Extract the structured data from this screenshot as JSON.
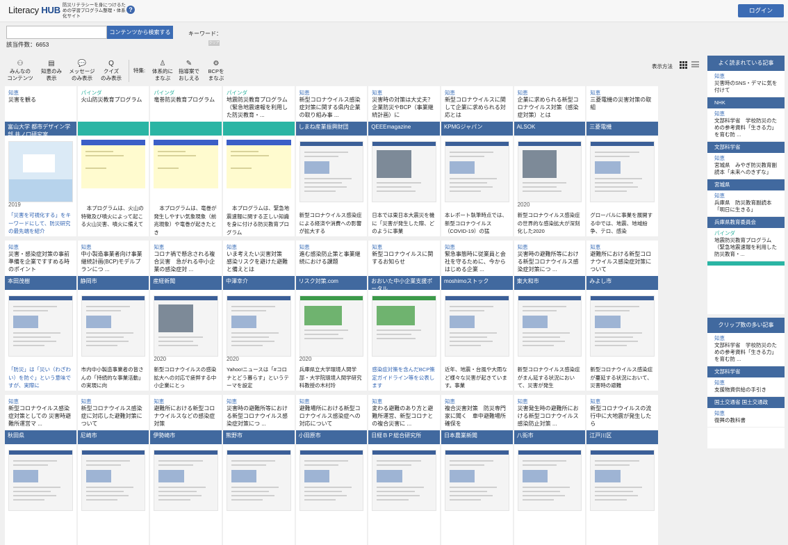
{
  "header": {
    "logo_prefix": "Literacy ",
    "logo_bold": "HUB",
    "tagline": "防災リテラシーを身につけるための学習プログラム整理・体系化サイト",
    "help_icon": "?",
    "login_label": "ログイン"
  },
  "search": {
    "input_value": "",
    "button_label": "コンテンツから検索する",
    "keyword_label": "キーワード：",
    "keyword_chip": "クリア",
    "count_label": "該当件数：6653"
  },
  "filters": [
    {
      "icon": "people-icon",
      "glyph": "⚇",
      "label1": "みんなの",
      "label2": "コンテンツ"
    },
    {
      "icon": "doc-icon",
      "glyph": "▤",
      "label1": "知恵のみ",
      "label2": "表示"
    },
    {
      "icon": "message-icon",
      "glyph": "💬",
      "label1": "メッセージ",
      "label2": "のみ表示"
    },
    {
      "icon": "quiz-icon",
      "glyph": "Q",
      "label1": "クイズ",
      "label2": "のみ表示"
    }
  ],
  "features_label": "特集:",
  "features": [
    {
      "icon": "person-icon",
      "glyph": "♙",
      "label1": "体系的に",
      "label2": "まなぶ"
    },
    {
      "icon": "book-icon",
      "glyph": "✎",
      "label1": "指導案で",
      "label2": "おしえる"
    },
    {
      "icon": "gear-icon",
      "glyph": "⚙",
      "label1": "BCPを",
      "label2": "まなぶ"
    }
  ],
  "view": {
    "label": "表示方法"
  },
  "cards": [
    {
      "cat": "知恵",
      "title": "災害を観る",
      "source": "富山大学 都市デザイン学部 井ノ口研究室",
      "teal": false,
      "thumb": "blue",
      "year": "2019",
      "desc": "「災害を可視化する」をキーワードにして、防災研究の最先端を紹介",
      "desc_blue": true,
      "pg": false
    },
    {
      "cat": "パインダ",
      "title": "火山防災教育プログラム",
      "source": "",
      "teal": true,
      "thumb": "yellow",
      "year": "",
      "desc": "本プログラムは、火山の特徴及び噴火によって起こる火山災害、噴火に備えて",
      "desc_blue": false,
      "pg": true
    },
    {
      "cat": "パインダ",
      "title": "竜巻防災教育プログラム",
      "source": "",
      "teal": true,
      "thumb": "yellow",
      "year": "",
      "desc": "本プログラムは、竜巻が発生しやすい気象現象（前兆現象）や竜巻が起きたとき",
      "desc_blue": false,
      "pg": true
    },
    {
      "cat": "パインダ",
      "title": "地震防災教育プログラム（緊急地震速報を利用した防災教育・...",
      "source": "",
      "teal": true,
      "thumb": "yellow",
      "year": "",
      "desc": "本プログラムは、緊急地震速報に関する正しい知識を身に付ける防災教育プログラム",
      "desc_blue": false,
      "pg": true
    },
    {
      "cat": "知恵",
      "title": "新型コロナウイルス感染症対策に関する県内企業の取り組み事 ...",
      "source": "しまね産業振興財団",
      "teal": false,
      "thumb": "doc",
      "year": "",
      "desc": "新型コロナウイルス感染症による経済や消費への影響が拡大する",
      "desc_blue": false,
      "pg": false
    },
    {
      "cat": "知恵",
      "title": "災害時の対策は大丈夫？企業防災やBCP（事業継続計画）に",
      "source": "QEEEmagazine",
      "teal": false,
      "thumb": "photo",
      "year": "",
      "desc": "日本では東日本大震災を機に「災害が発生した際、どのように事業",
      "desc_blue": false,
      "pg": false
    },
    {
      "cat": "知恵",
      "title": "新型コロナウイルスに関して企業に求められる対応とは",
      "source": "KPMGジャパン",
      "teal": false,
      "thumb": "doc",
      "year": "",
      "desc": "本レポート執筆時点では、新型コロナウイルス（COVID-19）の猛",
      "desc_blue": false,
      "pg": false
    },
    {
      "cat": "知恵",
      "title": "企業に求められる新型コロナウイルス対策（感染症対策）とは",
      "source": "ALSOK",
      "teal": false,
      "thumb": "photo",
      "year": "2020",
      "desc": "新型コロナウイルス感染症の世界的な感染拡大が深刻化した2020",
      "desc_blue": false,
      "pg": false
    },
    {
      "cat": "知恵",
      "title": "三菱電機の災害対策の取組",
      "source": "三菱電機",
      "teal": false,
      "thumb": "doc",
      "year": "",
      "desc": "グローバルに事業を展開する中では、地震、地域紛争、テロ、感染",
      "desc_blue": false,
      "pg": false
    },
    {
      "cat": "知恵",
      "title": "災害・感染症対策の事前準備を企業ですすめる時のポイント",
      "source": "本田茂樹",
      "teal": false,
      "thumb": "doc",
      "year": "",
      "desc": "「防災」は「災い（わざわい）を防ぐ」という意味ですが、実際に",
      "desc_blue": true,
      "pg": false
    },
    {
      "cat": "知恵",
      "title": "中小製造事業者向け事業継続計画(BCP)モデルプランにつ ...",
      "source": "静岡市",
      "teal": false,
      "thumb": "doc",
      "year": "",
      "desc": "市内中小製造事業者の皆さんの「持続的な事業活動」の実現に向",
      "desc_blue": false,
      "pg": false
    },
    {
      "cat": "知恵",
      "title": "コロナ禍で懸念される複合災害　急がれる中小企業の感染症対 ...",
      "source": "産経新聞",
      "teal": false,
      "thumb": "photo",
      "year": "2020",
      "desc": "新型コロナウイルスの感染拡大への対応で疲弊する中小企業にとっ",
      "desc_blue": false,
      "pg": false
    },
    {
      "cat": "知恵",
      "title": "いま考えたい災害対策　感染リスクを避けた避難と備えとは",
      "source": "中澤幸介",
      "teal": false,
      "thumb": "doc",
      "year": "2020",
      "desc": "Yahoo!ニュースは「#コロナとどう暮らす」というテーマを設定",
      "desc_blue": false,
      "pg": false
    },
    {
      "cat": "知恵",
      "title": "進む感染防止策と事業継続における課題",
      "source": "リスク対策.com",
      "teal": false,
      "thumb": "green",
      "year": "2020",
      "desc": "兵庫県立大学環境人間学部・大学院環境人間学研究科教授の木村玲",
      "desc_blue": false,
      "pg": false
    },
    {
      "cat": "知恵",
      "title": "新型コロナウイルスに関するお知らせ",
      "source": "おおいた中小企業支援ポータル",
      "teal": false,
      "thumb": "green",
      "year": "",
      "desc": "感染症対策を含んだBCP策定ガイドライン等を公表します",
      "desc_blue": true,
      "pg": false
    },
    {
      "cat": "知恵",
      "title": "緊急事態時に従業員と会社を守るために、今からはじめる企業 ...",
      "source": "moshimoストック",
      "teal": false,
      "thumb": "doc",
      "year": "",
      "desc": "近年、地震・台風や大雨など様々な災害が起きています。事業",
      "desc_blue": false,
      "pg": false
    },
    {
      "cat": "知恵",
      "title": "災害時の避難所等における新型コロナウイルス感染症対策につ ...",
      "source": "東大和市",
      "teal": false,
      "thumb": "doc",
      "year": "",
      "desc": "新型コロナウイルス感染症がまん延する状況において、災害が発生",
      "desc_blue": false,
      "pg": false
    },
    {
      "cat": "知恵",
      "title": "避難所における新型コロナウイルス感染症対策について",
      "source": "みよし市",
      "teal": false,
      "thumb": "doc",
      "year": "",
      "desc": "新型コロナウイルス感染症が蔓延する状況において、災害時の避難",
      "desc_blue": false,
      "pg": false
    },
    {
      "cat": "知恵",
      "title": "新型コロナウイルス感染症対策としての 災害時避難所運営マ ...",
      "source": "秋田県",
      "teal": false,
      "thumb": "doc",
      "year": "",
      "desc": "",
      "desc_blue": false,
      "pg": false
    },
    {
      "cat": "知恵",
      "title": "新型コロナウイルス感染症に対応した避難対策について",
      "source": "尼崎市",
      "teal": false,
      "thumb": "doc",
      "year": "",
      "desc": "",
      "desc_blue": false,
      "pg": false
    },
    {
      "cat": "知恵",
      "title": "避難所における新型コロナウイルスなどの感染症対策",
      "source": "伊勢崎市",
      "teal": false,
      "thumb": "doc",
      "year": "",
      "desc": "",
      "desc_blue": false,
      "pg": false
    },
    {
      "cat": "知恵",
      "title": "災害時の避難所等における新型コロナウイルス感染症対策につ ...",
      "source": "熊野市",
      "teal": false,
      "thumb": "doc",
      "year": "",
      "desc": "",
      "desc_blue": false,
      "pg": false
    },
    {
      "cat": "知恵",
      "title": "避難場所における新型コロナウイルス感染症への対応について",
      "source": "小田原市",
      "teal": false,
      "thumb": "doc",
      "year": "",
      "desc": "",
      "desc_blue": false,
      "pg": false
    },
    {
      "cat": "知恵",
      "title": "変わる避難のあり方と避難所運営、新型コロナとの複合災害に ...",
      "source": "日経ＢＰ総合研究所",
      "teal": false,
      "thumb": "doc",
      "year": "",
      "desc": "",
      "desc_blue": false,
      "pg": false
    },
    {
      "cat": "知恵",
      "title": "複合災害対策　防災専門家に聞く　車中避難場所確保を",
      "source": "日本農業新聞",
      "teal": false,
      "thumb": "doc",
      "year": "",
      "desc": "",
      "desc_blue": false,
      "pg": false
    },
    {
      "cat": "知恵",
      "title": "災害発生時の避難所における新型コロナウイルス感染防止対策 ...",
      "source": "八街市",
      "teal": false,
      "thumb": "doc",
      "year": "",
      "desc": "",
      "desc_blue": false,
      "pg": false
    },
    {
      "cat": "知恵",
      "title": "新型コロナウイルスの流行中に大地震が発生したら",
      "source": "江戸川区",
      "teal": false,
      "thumb": "doc",
      "year": "",
      "desc": "",
      "desc_blue": false,
      "pg": false
    }
  ],
  "sidebar_popular": {
    "heading": "よく読まれている記事",
    "items": [
      {
        "cat": "知恵",
        "title": "災害時のSNS・デマに気を付けて",
        "source": "NHK",
        "pg": false
      },
      {
        "cat": "知恵",
        "title": "文部科学省　学校防災のための参考資料「生きる力」を育む防 ...",
        "source": "文部科学省",
        "pg": false
      },
      {
        "cat": "知恵",
        "title": "宮城県　みやぎ防災教育副読本「未来へのきずな」",
        "source": "宮城県",
        "pg": false
      },
      {
        "cat": "知恵",
        "title": "兵庫県　防災教育副読本「明日に生きる」",
        "source": "兵庫県教育委員会",
        "pg": false
      },
      {
        "cat": "パインダ",
        "title": "地震防災教育プログラム（緊急地震速報を利用した防災教育・...",
        "source": "",
        "pg": true
      }
    ]
  },
  "sidebar_clips": {
    "heading": "クリップ数の多い記事",
    "items": [
      {
        "cat": "知恵",
        "title": "文部科学省　学校防災のための参考資料「生きる力」を育む防 ...",
        "source": "文部科学省",
        "pg": false
      },
      {
        "cat": "知恵",
        "title": "支援物資供給の手引き",
        "source": "国土交通省 国土交通政",
        "pg": false
      },
      {
        "cat": "知恵",
        "title": "復興の教科書",
        "source": "",
        "pg": false
      }
    ]
  }
}
